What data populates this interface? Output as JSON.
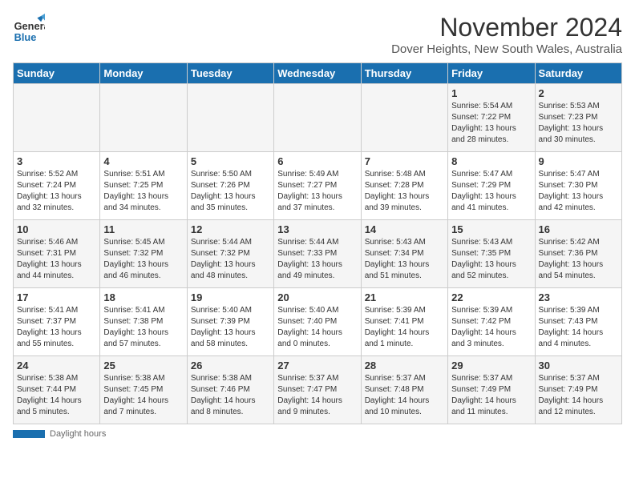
{
  "header": {
    "logo_general": "General",
    "logo_blue": "Blue",
    "title": "November 2024",
    "subtitle": "Dover Heights, New South Wales, Australia"
  },
  "weekdays": [
    "Sunday",
    "Monday",
    "Tuesday",
    "Wednesday",
    "Thursday",
    "Friday",
    "Saturday"
  ],
  "weeks": [
    [
      {
        "day": "",
        "info": ""
      },
      {
        "day": "",
        "info": ""
      },
      {
        "day": "",
        "info": ""
      },
      {
        "day": "",
        "info": ""
      },
      {
        "day": "",
        "info": ""
      },
      {
        "day": "1",
        "info": "Sunrise: 5:54 AM\nSunset: 7:22 PM\nDaylight: 13 hours\nand 28 minutes."
      },
      {
        "day": "2",
        "info": "Sunrise: 5:53 AM\nSunset: 7:23 PM\nDaylight: 13 hours\nand 30 minutes."
      }
    ],
    [
      {
        "day": "3",
        "info": "Sunrise: 5:52 AM\nSunset: 7:24 PM\nDaylight: 13 hours\nand 32 minutes."
      },
      {
        "day": "4",
        "info": "Sunrise: 5:51 AM\nSunset: 7:25 PM\nDaylight: 13 hours\nand 34 minutes."
      },
      {
        "day": "5",
        "info": "Sunrise: 5:50 AM\nSunset: 7:26 PM\nDaylight: 13 hours\nand 35 minutes."
      },
      {
        "day": "6",
        "info": "Sunrise: 5:49 AM\nSunset: 7:27 PM\nDaylight: 13 hours\nand 37 minutes."
      },
      {
        "day": "7",
        "info": "Sunrise: 5:48 AM\nSunset: 7:28 PM\nDaylight: 13 hours\nand 39 minutes."
      },
      {
        "day": "8",
        "info": "Sunrise: 5:47 AM\nSunset: 7:29 PM\nDaylight: 13 hours\nand 41 minutes."
      },
      {
        "day": "9",
        "info": "Sunrise: 5:47 AM\nSunset: 7:30 PM\nDaylight: 13 hours\nand 42 minutes."
      }
    ],
    [
      {
        "day": "10",
        "info": "Sunrise: 5:46 AM\nSunset: 7:31 PM\nDaylight: 13 hours\nand 44 minutes."
      },
      {
        "day": "11",
        "info": "Sunrise: 5:45 AM\nSunset: 7:32 PM\nDaylight: 13 hours\nand 46 minutes."
      },
      {
        "day": "12",
        "info": "Sunrise: 5:44 AM\nSunset: 7:32 PM\nDaylight: 13 hours\nand 48 minutes."
      },
      {
        "day": "13",
        "info": "Sunrise: 5:44 AM\nSunset: 7:33 PM\nDaylight: 13 hours\nand 49 minutes."
      },
      {
        "day": "14",
        "info": "Sunrise: 5:43 AM\nSunset: 7:34 PM\nDaylight: 13 hours\nand 51 minutes."
      },
      {
        "day": "15",
        "info": "Sunrise: 5:43 AM\nSunset: 7:35 PM\nDaylight: 13 hours\nand 52 minutes."
      },
      {
        "day": "16",
        "info": "Sunrise: 5:42 AM\nSunset: 7:36 PM\nDaylight: 13 hours\nand 54 minutes."
      }
    ],
    [
      {
        "day": "17",
        "info": "Sunrise: 5:41 AM\nSunset: 7:37 PM\nDaylight: 13 hours\nand 55 minutes."
      },
      {
        "day": "18",
        "info": "Sunrise: 5:41 AM\nSunset: 7:38 PM\nDaylight: 13 hours\nand 57 minutes."
      },
      {
        "day": "19",
        "info": "Sunrise: 5:40 AM\nSunset: 7:39 PM\nDaylight: 13 hours\nand 58 minutes."
      },
      {
        "day": "20",
        "info": "Sunrise: 5:40 AM\nSunset: 7:40 PM\nDaylight: 14 hours\nand 0 minutes."
      },
      {
        "day": "21",
        "info": "Sunrise: 5:39 AM\nSunset: 7:41 PM\nDaylight: 14 hours\nand 1 minute."
      },
      {
        "day": "22",
        "info": "Sunrise: 5:39 AM\nSunset: 7:42 PM\nDaylight: 14 hours\nand 3 minutes."
      },
      {
        "day": "23",
        "info": "Sunrise: 5:39 AM\nSunset: 7:43 PM\nDaylight: 14 hours\nand 4 minutes."
      }
    ],
    [
      {
        "day": "24",
        "info": "Sunrise: 5:38 AM\nSunset: 7:44 PM\nDaylight: 14 hours\nand 5 minutes."
      },
      {
        "day": "25",
        "info": "Sunrise: 5:38 AM\nSunset: 7:45 PM\nDaylight: 14 hours\nand 7 minutes."
      },
      {
        "day": "26",
        "info": "Sunrise: 5:38 AM\nSunset: 7:46 PM\nDaylight: 14 hours\nand 8 minutes."
      },
      {
        "day": "27",
        "info": "Sunrise: 5:37 AM\nSunset: 7:47 PM\nDaylight: 14 hours\nand 9 minutes."
      },
      {
        "day": "28",
        "info": "Sunrise: 5:37 AM\nSunset: 7:48 PM\nDaylight: 14 hours\nand 10 minutes."
      },
      {
        "day": "29",
        "info": "Sunrise: 5:37 AM\nSunset: 7:49 PM\nDaylight: 14 hours\nand 11 minutes."
      },
      {
        "day": "30",
        "info": "Sunrise: 5:37 AM\nSunset: 7:49 PM\nDaylight: 14 hours\nand 12 minutes."
      }
    ]
  ],
  "footer": {
    "daylight_label": "Daylight hours"
  }
}
